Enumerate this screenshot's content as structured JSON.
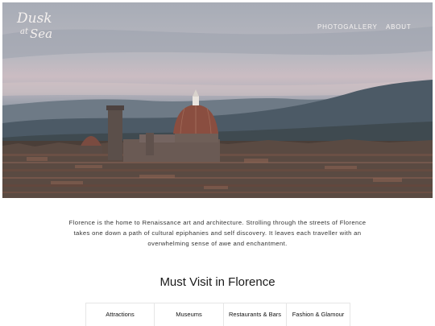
{
  "brand": {
    "line1": "Dusk",
    "line2": "at",
    "line3": "Sea"
  },
  "nav": {
    "items": [
      "PHOTOGALLERY",
      "ABOUT"
    ]
  },
  "intro": {
    "lines": [
      "Florence is the home to Renaissance art and architecture. Strolling through the streets of Florence",
      "takes one down a path of cultural epiphanies and self discovery. It leaves each traveller with an",
      "overwhelming sense of awe and enchantment."
    ]
  },
  "section": {
    "title": "Must Visit in Florence"
  },
  "tabs": [
    "Attractions",
    "Museums",
    "Restaurants & Bars",
    "Fashion & Glamour"
  ]
}
